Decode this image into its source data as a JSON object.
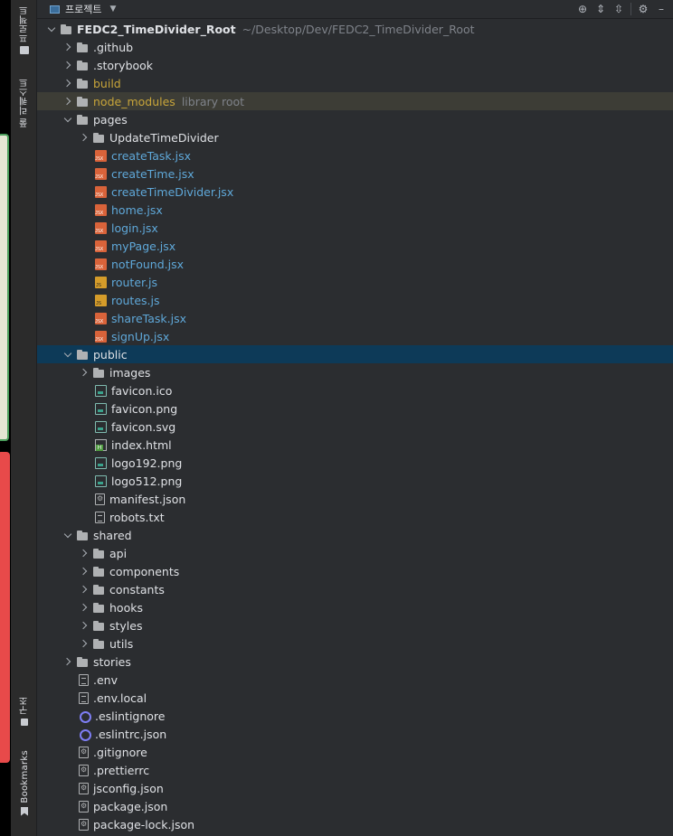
{
  "sidebar": {
    "project_tab": "프로젝트",
    "pull_requests_tab": "풀 리퀘스트",
    "structure_tab": "구조",
    "bookmarks_tab": "Bookmarks"
  },
  "header": {
    "title": "프로젝트"
  },
  "tree": [
    {
      "label": "FEDC2_TimeDivider_Root",
      "sub": "~/Desktop/Dev/FEDC2_TimeDivider_Root",
      "depth": 0,
      "chev": "open",
      "icon": "folder-icon",
      "style": "root"
    },
    {
      "label": ".github",
      "depth": 1,
      "chev": "closed",
      "icon": "folder-icon"
    },
    {
      "label": ".storybook",
      "depth": 1,
      "chev": "closed",
      "icon": "folder-icon"
    },
    {
      "label": "build",
      "depth": 1,
      "chev": "closed",
      "icon": "folder-icon",
      "style": "yellow"
    },
    {
      "label": "node_modules",
      "sub": "library root",
      "depth": 1,
      "chev": "closed",
      "icon": "folder-icon",
      "style": "yellow",
      "row": "lib"
    },
    {
      "label": "pages",
      "depth": 1,
      "chev": "open",
      "icon": "folder-icon"
    },
    {
      "label": "UpdateTimeDivider",
      "depth": 2,
      "chev": "closed",
      "icon": "folder-icon"
    },
    {
      "label": "createTask.jsx",
      "depth": 2,
      "chev": "none",
      "icon": "jsx-file-icon",
      "style": "blue"
    },
    {
      "label": "createTime.jsx",
      "depth": 2,
      "chev": "none",
      "icon": "jsx-file-icon",
      "style": "blue"
    },
    {
      "label": "createTimeDivider.jsx",
      "depth": 2,
      "chev": "none",
      "icon": "jsx-file-icon",
      "style": "blue"
    },
    {
      "label": "home.jsx",
      "depth": 2,
      "chev": "none",
      "icon": "jsx-file-icon",
      "style": "blue"
    },
    {
      "label": "login.jsx",
      "depth": 2,
      "chev": "none",
      "icon": "jsx-file-icon",
      "style": "blue"
    },
    {
      "label": "myPage.jsx",
      "depth": 2,
      "chev": "none",
      "icon": "jsx-file-icon",
      "style": "blue"
    },
    {
      "label": "notFound.jsx",
      "depth": 2,
      "chev": "none",
      "icon": "jsx-file-icon",
      "style": "blue"
    },
    {
      "label": "router.js",
      "depth": 2,
      "chev": "none",
      "icon": "js-file-icon",
      "style": "blue"
    },
    {
      "label": "routes.js",
      "depth": 2,
      "chev": "none",
      "icon": "js-file-icon",
      "style": "blue"
    },
    {
      "label": "shareTask.jsx",
      "depth": 2,
      "chev": "none",
      "icon": "jsx-file-icon",
      "style": "blue"
    },
    {
      "label": "signUp.jsx",
      "depth": 2,
      "chev": "none",
      "icon": "jsx-file-icon",
      "style": "blue"
    },
    {
      "label": "public",
      "depth": 1,
      "chev": "open",
      "icon": "folder-icon",
      "row": "sel"
    },
    {
      "label": "images",
      "depth": 2,
      "chev": "closed",
      "icon": "folder-icon"
    },
    {
      "label": "favicon.ico",
      "depth": 2,
      "chev": "none",
      "icon": "image-file-icon"
    },
    {
      "label": "favicon.png",
      "depth": 2,
      "chev": "none",
      "icon": "image-file-icon"
    },
    {
      "label": "favicon.svg",
      "depth": 2,
      "chev": "none",
      "icon": "image-file-icon"
    },
    {
      "label": "index.html",
      "depth": 2,
      "chev": "none",
      "icon": "html-file-icon"
    },
    {
      "label": "logo192.png",
      "depth": 2,
      "chev": "none",
      "icon": "image-file-icon"
    },
    {
      "label": "logo512.png",
      "depth": 2,
      "chev": "none",
      "icon": "image-file-icon"
    },
    {
      "label": "manifest.json",
      "depth": 2,
      "chev": "none",
      "icon": "config-file-icon"
    },
    {
      "label": "robots.txt",
      "depth": 2,
      "chev": "none",
      "icon": "text-file-icon"
    },
    {
      "label": "shared",
      "depth": 1,
      "chev": "open",
      "icon": "folder-icon"
    },
    {
      "label": "api",
      "depth": 2,
      "chev": "closed",
      "icon": "folder-icon"
    },
    {
      "label": "components",
      "depth": 2,
      "chev": "closed",
      "icon": "folder-icon"
    },
    {
      "label": "constants",
      "depth": 2,
      "chev": "closed",
      "icon": "folder-icon"
    },
    {
      "label": "hooks",
      "depth": 2,
      "chev": "closed",
      "icon": "folder-icon"
    },
    {
      "label": "styles",
      "depth": 2,
      "chev": "closed",
      "icon": "folder-icon"
    },
    {
      "label": "utils",
      "depth": 2,
      "chev": "closed",
      "icon": "folder-icon"
    },
    {
      "label": "stories",
      "depth": 1,
      "chev": "closed",
      "icon": "folder-icon"
    },
    {
      "label": ".env",
      "depth": 1,
      "chev": "none",
      "icon": "text-file-icon"
    },
    {
      "label": ".env.local",
      "depth": 1,
      "chev": "none",
      "icon": "text-file-icon"
    },
    {
      "label": ".eslintignore",
      "depth": 1,
      "chev": "none",
      "icon": "eslint-icon"
    },
    {
      "label": ".eslintrc.json",
      "depth": 1,
      "chev": "none",
      "icon": "eslint-icon"
    },
    {
      "label": ".gitignore",
      "depth": 1,
      "chev": "none",
      "icon": "config-file-icon"
    },
    {
      "label": ".prettierrc",
      "depth": 1,
      "chev": "none",
      "icon": "config-file-icon"
    },
    {
      "label": "jsconfig.json",
      "depth": 1,
      "chev": "none",
      "icon": "config-file-icon"
    },
    {
      "label": "package.json",
      "depth": 1,
      "chev": "none",
      "icon": "config-file-icon"
    },
    {
      "label": "package-lock.json",
      "depth": 1,
      "chev": "none",
      "icon": "config-file-icon"
    }
  ]
}
